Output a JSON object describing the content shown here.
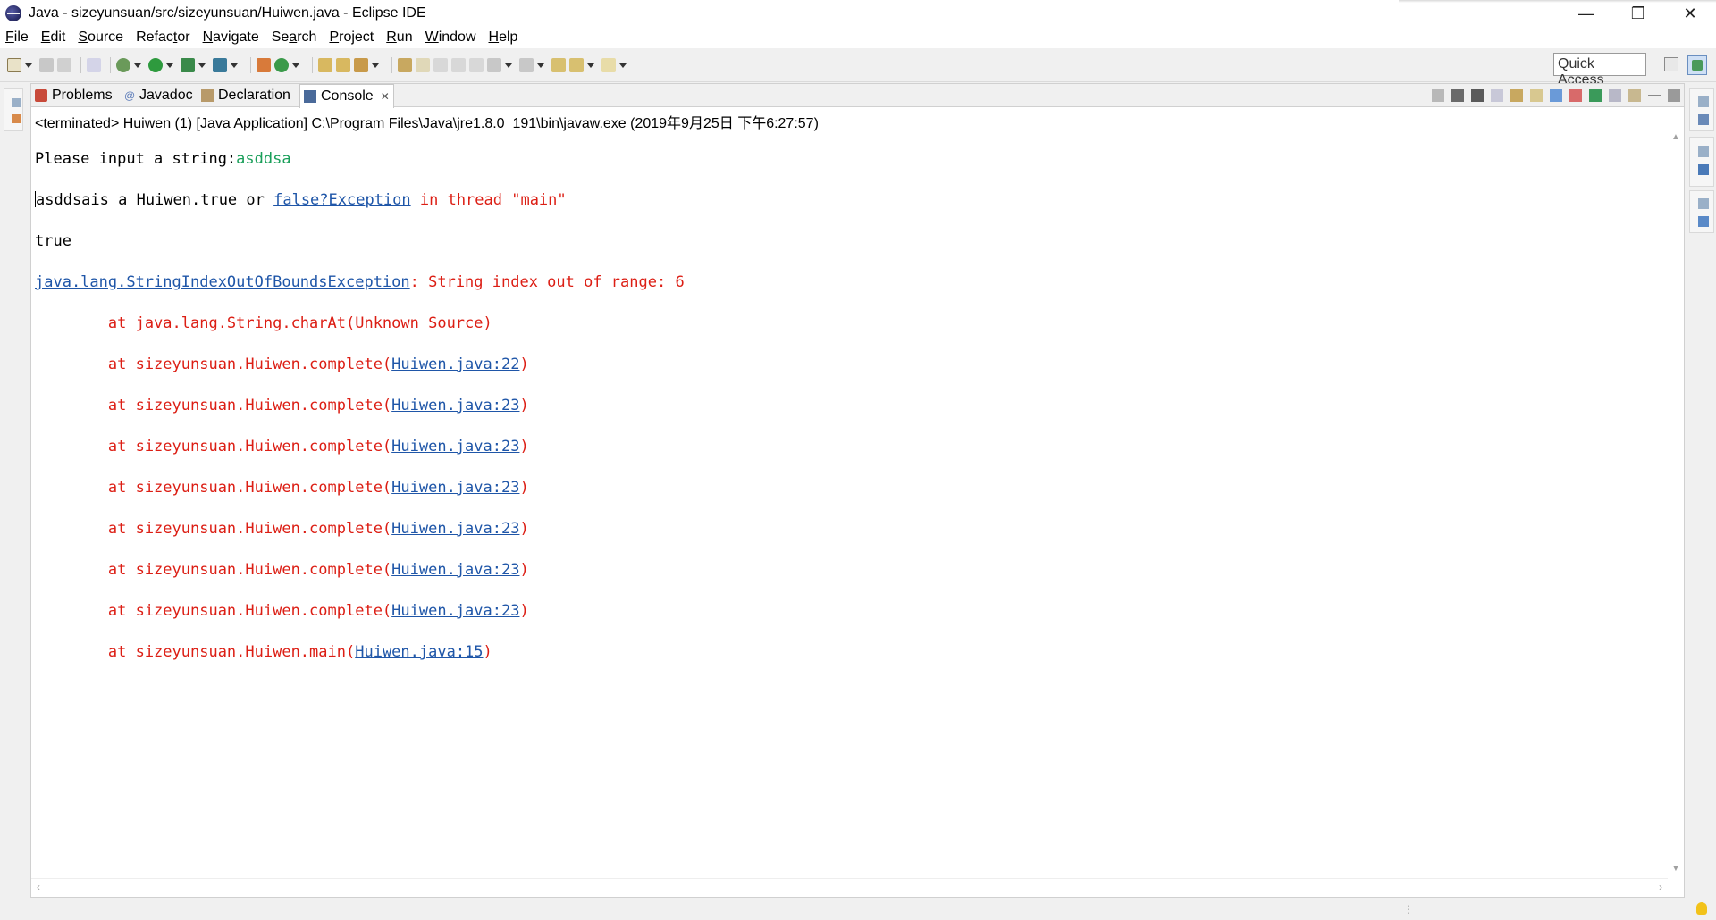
{
  "window": {
    "title": "Java - sizeyunsuan/src/sizeyunsuan/Huiwen.java - Eclipse IDE",
    "controls": {
      "minimize": "—",
      "restore": "❐",
      "close": "✕"
    }
  },
  "menubar": {
    "items": [
      {
        "mnemonic": "F",
        "rest": "ile"
      },
      {
        "mnemonic": "E",
        "rest": "dit"
      },
      {
        "mnemonic": "S",
        "rest": "ource"
      },
      {
        "prefix": "Refac",
        "mnemonic": "t",
        "rest": "or"
      },
      {
        "mnemonic": "N",
        "rest": "avigate"
      },
      {
        "prefix": "Se",
        "mnemonic": "a",
        "rest": "rch"
      },
      {
        "mnemonic": "P",
        "rest": "roject"
      },
      {
        "mnemonic": "R",
        "rest": "un"
      },
      {
        "mnemonic": "W",
        "rest": "indow"
      },
      {
        "mnemonic": "H",
        "rest": "elp"
      }
    ]
  },
  "toolbar": {
    "quick_access": "Quick Access"
  },
  "tabs": {
    "problems": "Problems",
    "javadoc": "Javadoc",
    "declaration": "Declaration",
    "console": "Console"
  },
  "console": {
    "header": "<terminated> Huiwen (1) [Java Application] C:\\Program Files\\Java\\jre1.8.0_191\\bin\\javaw.exe (2019年9月25日 下午6:27:57)",
    "line1_prompt": "Please input a string:",
    "line1_input": "asddsa",
    "line2_a": "asddsais a Huiwen.true or ",
    "line2_link": "false?Exception",
    "line2_b": " in thread \"main\"",
    "line3": "true",
    "line4_link": "java.lang.StringIndexOutOfBoundsException",
    "line4_rest": ": String index out of range: 6",
    "line5": "        at java.lang.String.charAt(Unknown Source)",
    "frames": [
      {
        "prefix": "        at sizeyunsuan.Huiwen.complete(",
        "link": "Huiwen.java:22",
        "suffix": ")"
      },
      {
        "prefix": "        at sizeyunsuan.Huiwen.complete(",
        "link": "Huiwen.java:23",
        "suffix": ")"
      },
      {
        "prefix": "        at sizeyunsuan.Huiwen.complete(",
        "link": "Huiwen.java:23",
        "suffix": ")"
      },
      {
        "prefix": "        at sizeyunsuan.Huiwen.complete(",
        "link": "Huiwen.java:23",
        "suffix": ")"
      },
      {
        "prefix": "        at sizeyunsuan.Huiwen.complete(",
        "link": "Huiwen.java:23",
        "suffix": ")"
      },
      {
        "prefix": "        at sizeyunsuan.Huiwen.complete(",
        "link": "Huiwen.java:23",
        "suffix": ")"
      },
      {
        "prefix": "        at sizeyunsuan.Huiwen.complete(",
        "link": "Huiwen.java:23",
        "suffix": ")"
      },
      {
        "prefix": "        at sizeyunsuan.Huiwen.main(",
        "link": "Huiwen.java:15",
        "suffix": ")"
      }
    ]
  },
  "colors": {
    "stderr": "#dc1e14",
    "stdin": "#1a9f5a",
    "link": "#1f56a8"
  }
}
